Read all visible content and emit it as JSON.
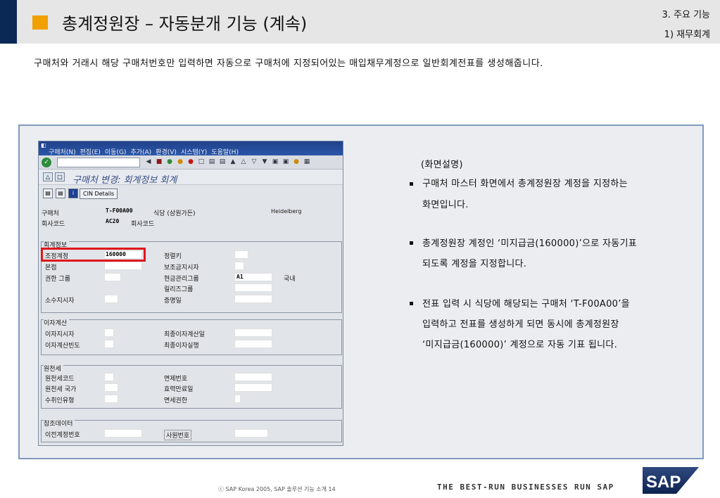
{
  "header": {
    "title": "총계정원장 – 자동분개 기능 (계속)",
    "section": "3. 주요 기능",
    "subsection": "1) 재무회계"
  },
  "intro": "구매처와 거래시 해당 구매처번호만 입력하면 자동으로 구매처에 지정되어있는 매입채무계정으로 일반회계전표를 생성해줍니다.",
  "sap_window": {
    "menu": [
      "구매처(N)",
      "편집(E)",
      "이동(G)",
      "추가(A)",
      "환경(V)",
      "시스템(Y)",
      "도움말(H)"
    ],
    "title": "구매처 변경: 회계정보 회계",
    "cin_button": "CIN Details",
    "vendor_label": "구매처",
    "vendor_value": "T-F00A00",
    "vendor_name": "식당 (삼원가든)",
    "vendor_city": "Heidelberg",
    "company_label": "회사코드",
    "company_value": "AC20",
    "company_text": "회사코드",
    "groups": {
      "account": {
        "title": "회계정보",
        "recon_account_label": "조정계정",
        "recon_account_value": "160000",
        "head_office_label": "본점",
        "auth_group_label": "권한 그룹",
        "minority_label": "소수지시자",
        "sort_key_label": "정렬키",
        "subsidy_label": "보조금지시자",
        "cash_mgmt_label": "현금관리그룹",
        "cash_mgmt_value": "A1",
        "cash_mgmt_text": "국내",
        "release_group_label": "릴리즈그룹",
        "certificate_label": "증명일"
      },
      "interest": {
        "title": "이자계산",
        "indicator_label": "이자지시자",
        "frequency_label": "이자계산빈도",
        "last_calc_label": "최종이자계산일",
        "last_run_label": "최종이자실행"
      },
      "withholding": {
        "title": "원천세",
        "code_label": "원천세코드",
        "country_label": "원천세 국가",
        "recipient_label": "수취인유형",
        "exemption_no_label": "면제번호",
        "valid_until_label": "효력만료일",
        "authority_label": "면세권한"
      },
      "reference": {
        "title": "참조데이터",
        "prev_account_label": "이전계정번호",
        "personnel_label": "사원번호"
      }
    }
  },
  "explanation": {
    "heading": "(화면설명)",
    "bullets": [
      [
        "구매처 마스터 화면에서 총계정원장 계정을 지정하는",
        "화면입니다."
      ],
      [
        "총계정원장 계정인 ‘미지급금(160000)’으로 자동기표",
        "되도록 계정을 지정합니다."
      ],
      [
        "전표 입력 시 식당에 해당되는 구매처 ‘T-F00A00’을",
        "입력하고 전표를 생성하게 되면 동시에 총계정원장",
        "‘미지급금(160000)’ 계정으로 자동 기표 됩니다."
      ]
    ]
  },
  "footer": {
    "copyright": "ⓒ  SAP Korea 2005, SAP 솔루션 기능 소개   14",
    "slogan": "THE BEST-RUN BUSINESSES RUN SAP",
    "logo_text": "SAP"
  },
  "colors": {
    "header_bg": "#e6e6e6",
    "accent_square": "#f0a000",
    "navy": "#0a2a55",
    "frame_border": "#7f9bbd",
    "highlight": "#e0161c",
    "sap_blue": "#2b56a8"
  }
}
